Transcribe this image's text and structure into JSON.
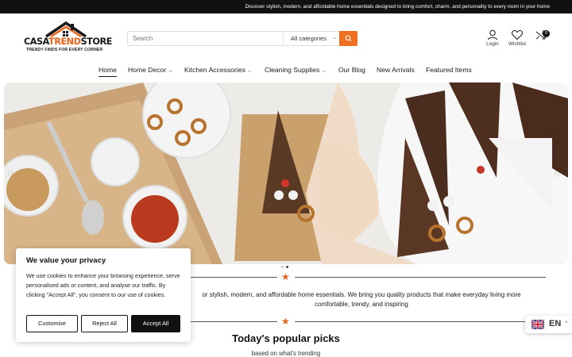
{
  "topbar": {
    "message": "Discover stylish, modern, and affordable home essentials designed to bring comfort, charm, and personality to every room in your home"
  },
  "logo": {
    "brand_part1": "CASA",
    "brand_part2": "TREND",
    "brand_part3": "STORE",
    "tagline": "TRENDY FINDS FOR EVERY CORNER"
  },
  "search": {
    "placeholder": "Search",
    "category": "All categories",
    "button_icon": "search-icon"
  },
  "header_icons": {
    "login": "Login",
    "wishlist": "Wishlist",
    "compare_count": "0"
  },
  "nav": {
    "items": [
      {
        "label": "Home",
        "dropdown": false
      },
      {
        "label": "Home Decor",
        "dropdown": true
      },
      {
        "label": "Kitchen Accessories",
        "dropdown": true
      },
      {
        "label": "Cleaning Supplies",
        "dropdown": true
      },
      {
        "label": "Our Blog",
        "dropdown": false
      },
      {
        "label": "New Arrivals",
        "dropdown": false
      },
      {
        "label": "Featured Items",
        "dropdown": false
      }
    ]
  },
  "hero": {
    "prev_icon": "chevron-left-icon",
    "next_icon": "chevron-right-icon",
    "slide_count": 2,
    "active_slide": 2
  },
  "intro": {
    "text": "or stylish, modern, and affordable home essentials. We bring you quality products that make everyday living more comfortable, trendy, and inspiring"
  },
  "picks": {
    "title": "Today's popular picks",
    "subtitle": "based on what's trending"
  },
  "cookie": {
    "title": "We value your privacy",
    "body": "We use cookies to enhance your browsing experience, serve personalised ads or content, and analyse our traffic. By clicking \"Accept All\", you consent to our use of cookies.",
    "customise": "Customise",
    "reject": "Reject All",
    "accept": "Accept All"
  },
  "language": {
    "code": "EN"
  },
  "colors": {
    "accent": "#e8621c",
    "topbar": "#111111"
  }
}
